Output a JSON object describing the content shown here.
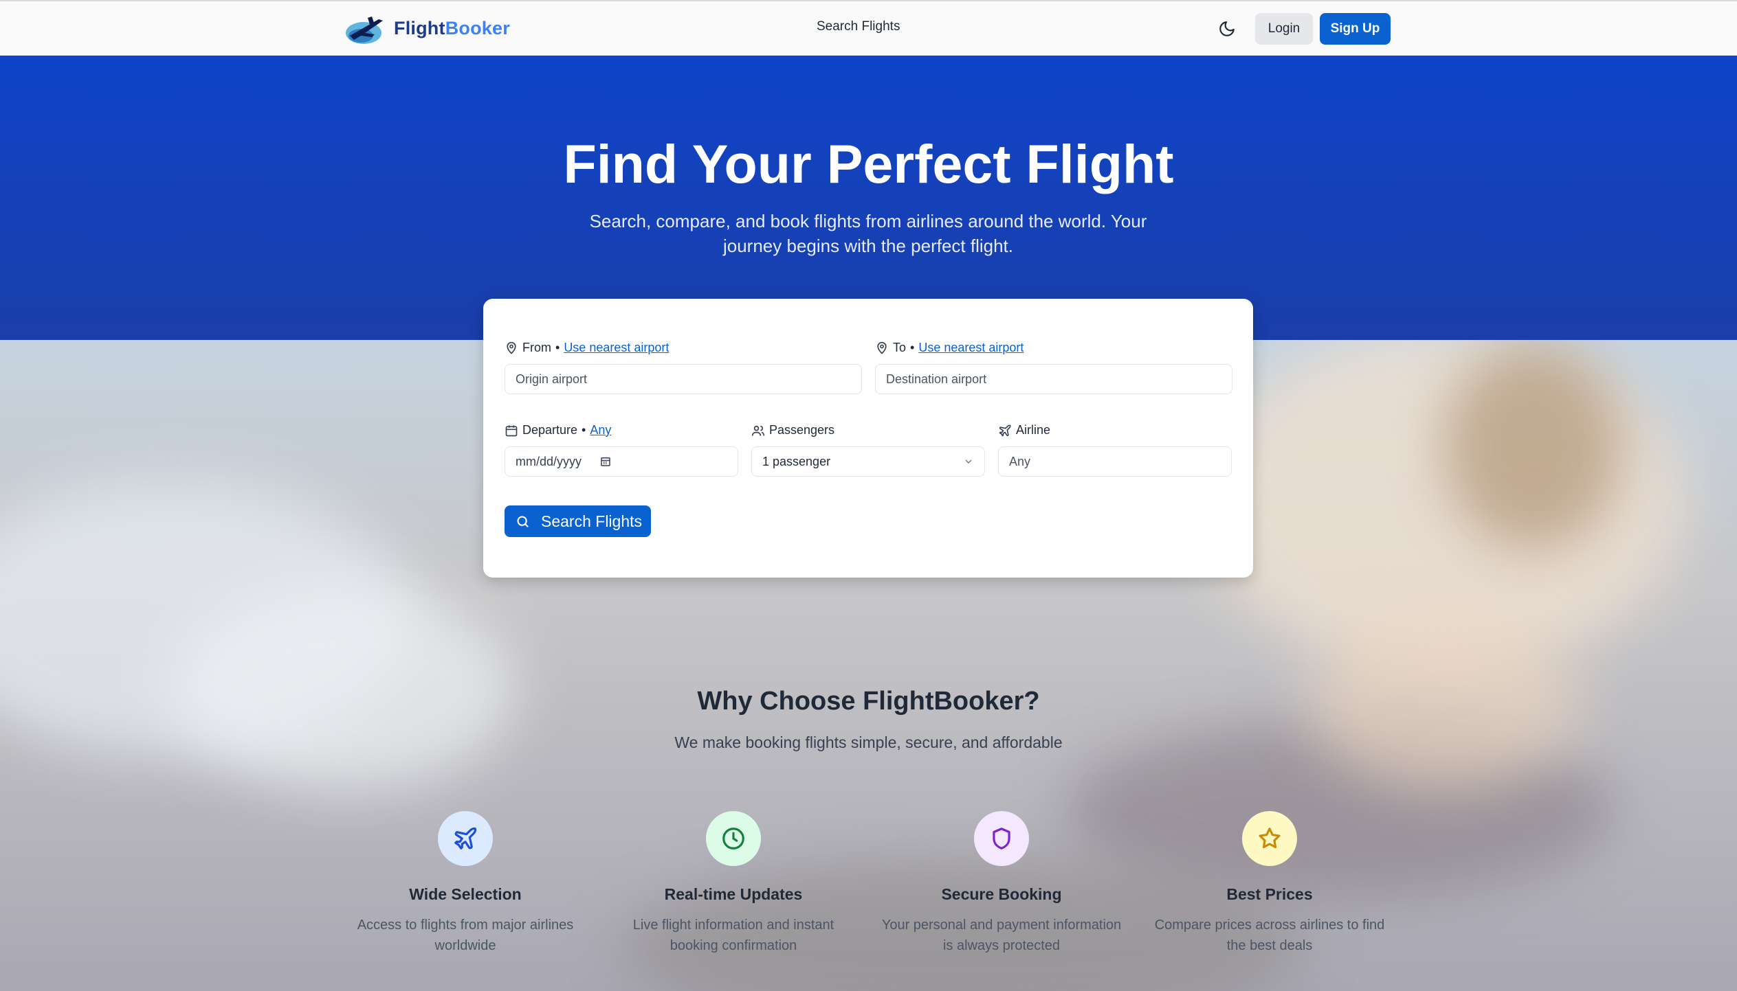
{
  "brand": {
    "part1": "Flight",
    "part2": "Booker"
  },
  "nav": {
    "search_link": "Search Flights",
    "login": "Login",
    "signup": "Sign Up"
  },
  "hero": {
    "title": "Find Your Perfect Flight",
    "subtitle": "Search, compare, and book flights from airlines around the world. Your journey begins with the perfect flight."
  },
  "search": {
    "from_label": "From",
    "from_link": "Use nearest airport",
    "from_placeholder": "Origin airport",
    "to_label": "To",
    "to_link": "Use nearest airport",
    "to_placeholder": "Destination airport",
    "departure_label": "Departure",
    "departure_link": "Any",
    "departure_placeholder": "mm/dd/yyyy",
    "passengers_label": "Passengers",
    "passengers_value": "1 passenger",
    "airline_label": "Airline",
    "airline_placeholder": "Any",
    "button": "Search Flights",
    "separator": "•"
  },
  "why": {
    "title": "Why Choose FlightBooker?",
    "subtitle": "We make booking flights simple, secure, and affordable",
    "features": [
      {
        "title": "Wide Selection",
        "desc": "Access to flights from major airlines worldwide",
        "icon": "plane-icon",
        "bg": "#dbeafe",
        "color": "#1d4ed8"
      },
      {
        "title": "Real-time Updates",
        "desc": "Live flight information and instant booking confirmation",
        "icon": "clock-icon",
        "bg": "#dcfce7",
        "color": "#15803d"
      },
      {
        "title": "Secure Booking",
        "desc": "Your personal and payment information is always protected",
        "icon": "shield-icon",
        "bg": "#f3e8ff",
        "color": "#7e22ce"
      },
      {
        "title": "Best Prices",
        "desc": "Compare prices across airlines to find the best deals",
        "icon": "star-icon",
        "bg": "#fef9c3",
        "color": "#ca8a04"
      }
    ]
  },
  "colors": {
    "primary": "#0a62d0",
    "hero": "#0f44c9"
  }
}
